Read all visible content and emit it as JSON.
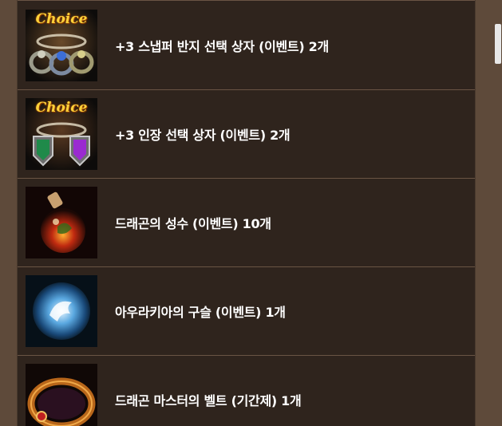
{
  "items": [
    {
      "label": "+3 스냅퍼 반지 선택 상자 (이벤트) 2개",
      "icon": "snapper-ring-choice-box-icon",
      "badge": "Choice"
    },
    {
      "label": "+3 인장 선택 상자 (이벤트) 2개",
      "icon": "seal-choice-box-icon",
      "badge": "Choice"
    },
    {
      "label": "드래곤의 성수 (이벤트) 10개",
      "icon": "dragon-holy-water-icon"
    },
    {
      "label": "아우라키아의 구슬 (이벤트) 1개",
      "icon": "aurakia-orb-icon"
    },
    {
      "label": "드래곤 마스터의 벨트 (기간제) 1개",
      "icon": "dragon-master-belt-icon"
    }
  ],
  "colors": {
    "page_bg": "#5e4a3a",
    "panel_bg": "#2f241d",
    "divider": "#6a5444",
    "text": "#ffffff",
    "choice_gold": "#ffd23a"
  }
}
